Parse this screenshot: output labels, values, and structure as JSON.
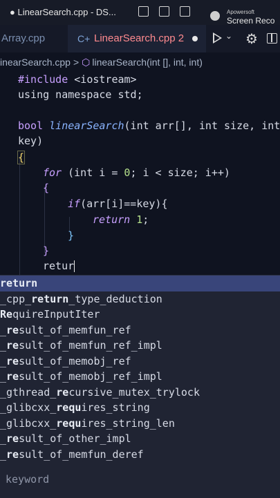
{
  "window": {
    "title": "● LinearSearch.cpp - DS..."
  },
  "watermark": {
    "brand": "Apowersoft",
    "label": "Screen Reco"
  },
  "tabs": [
    {
      "label": "Array.cpp"
    },
    {
      "label": "LinearSearch.cpp 2"
    }
  ],
  "breadcrumb": {
    "file": "inearSearch.cpp",
    "symbol": "linearSearch(int [], int, int)"
  },
  "code": {
    "l1_kw": "#include",
    "l1_rest": " <iostream>",
    "l2": "using namespace std;",
    "l3_kw": "bool",
    "l3_fn": "linearSearch",
    "l3_rest": "(int arr[], int size, int",
    "l4": "key)",
    "l5": "{",
    "l6_kw": "for",
    "l6_rest_a": " (int i = ",
    "l6_num": "0",
    "l6_rest_b": "; i < size; i++)",
    "l7": "{",
    "l8_kw": "if",
    "l8_rest": "(arr[i]==key){",
    "l9_kw": "return",
    "l9_num": "1",
    "l9_end": ";",
    "l10": "}",
    "l11": "}",
    "l12": "retur"
  },
  "suggestions": [
    {
      "pre": "",
      "match": "return",
      "post": ""
    },
    {
      "pre": "_cpp_",
      "match": "return",
      "post": "_type_deduction"
    },
    {
      "pre": "",
      "match": "Re",
      "post": "quireInputIter"
    },
    {
      "pre": "_",
      "match": "re",
      "post": "sult_of_memfun_ref"
    },
    {
      "pre": "_",
      "match": "re",
      "post": "sult_of_memfun_ref_impl"
    },
    {
      "pre": "_",
      "match": "re",
      "post": "sult_of_memobj_ref"
    },
    {
      "pre": "_",
      "match": "re",
      "post": "sult_of_memobj_ref_impl"
    },
    {
      "pre": "_gthread_",
      "match": "re",
      "post": "cursive_mutex_trylock"
    },
    {
      "pre": "_glibcxx_",
      "match": "requ",
      "post": "ires_string"
    },
    {
      "pre": "_glibcxx_",
      "match": "requ",
      "post": "ires_string_len"
    },
    {
      "pre": "_",
      "match": "re",
      "post": "sult_of_other_impl"
    },
    {
      "pre": "_",
      "match": "re",
      "post": "sult_of_memfun_deref"
    }
  ],
  "detail": "keyword",
  "colors": {
    "accent": "#39457a",
    "tab_modified": "#ff8a8f"
  }
}
